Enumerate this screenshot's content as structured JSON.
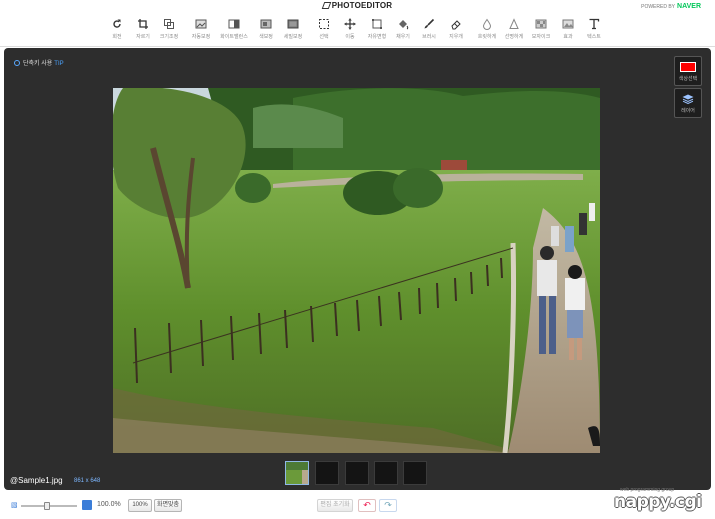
{
  "app": {
    "title": "PHOTOEDITOR",
    "powered_by": "POWERED BY",
    "brand": "NAVER"
  },
  "toolbar": {
    "tools": [
      {
        "name": "rotate",
        "label": "회전",
        "icon": "rotate-icon"
      },
      {
        "name": "crop",
        "label": "자르기",
        "icon": "crop-icon"
      },
      {
        "name": "resize",
        "label": "크기조정",
        "icon": "resize-icon"
      },
      {
        "name": "auto-correct",
        "label": "자동보정",
        "icon": "auto-correct-icon"
      },
      {
        "name": "white-balance",
        "label": "화이트밸런스",
        "icon": "white-balance-icon"
      },
      {
        "name": "color-correct",
        "label": "색보정",
        "icon": "color-correct-icon"
      },
      {
        "name": "detail-correct",
        "label": "세밀보정",
        "icon": "detail-correct-icon"
      },
      {
        "name": "select",
        "label": "선택",
        "icon": "select-icon"
      },
      {
        "name": "move",
        "label": "이동",
        "icon": "move-icon"
      },
      {
        "name": "free-transform",
        "label": "자유변형",
        "icon": "free-transform-icon"
      },
      {
        "name": "fill",
        "label": "채우기",
        "icon": "fill-icon"
      },
      {
        "name": "brush",
        "label": "브러시",
        "icon": "brush-icon"
      },
      {
        "name": "eraser",
        "label": "지우개",
        "icon": "eraser-icon"
      },
      {
        "name": "blur",
        "label": "흐릿하게",
        "icon": "blur-icon"
      },
      {
        "name": "sharpen",
        "label": "선명하게",
        "icon": "sharpen-icon"
      },
      {
        "name": "mosaic",
        "label": "모자이크",
        "icon": "mosaic-icon"
      },
      {
        "name": "effect",
        "label": "효과",
        "icon": "effect-icon"
      },
      {
        "name": "text",
        "label": "텍스트",
        "icon": "text-icon"
      }
    ]
  },
  "editor": {
    "tip_text": "단축키 사용",
    "tip_badge": "TIP",
    "color_select_label": "색상선택",
    "selected_color": "#ff0000",
    "layer_label": "레이어",
    "file_name": "@Sample1.jpg",
    "file_size": "861 x 648",
    "thumbnail_count": 5
  },
  "bottom": {
    "zoom_value": "100.0%",
    "zoom_fraction": 0.45,
    "btn_100": "100%",
    "btn_fit": "화면맞춤",
    "btn_reset": "편집 초기화",
    "undo_symbol": "↶",
    "redo_symbol": "↷"
  },
  "watermark": {
    "sub": "web programming group",
    "main": "nappy.cgi"
  }
}
